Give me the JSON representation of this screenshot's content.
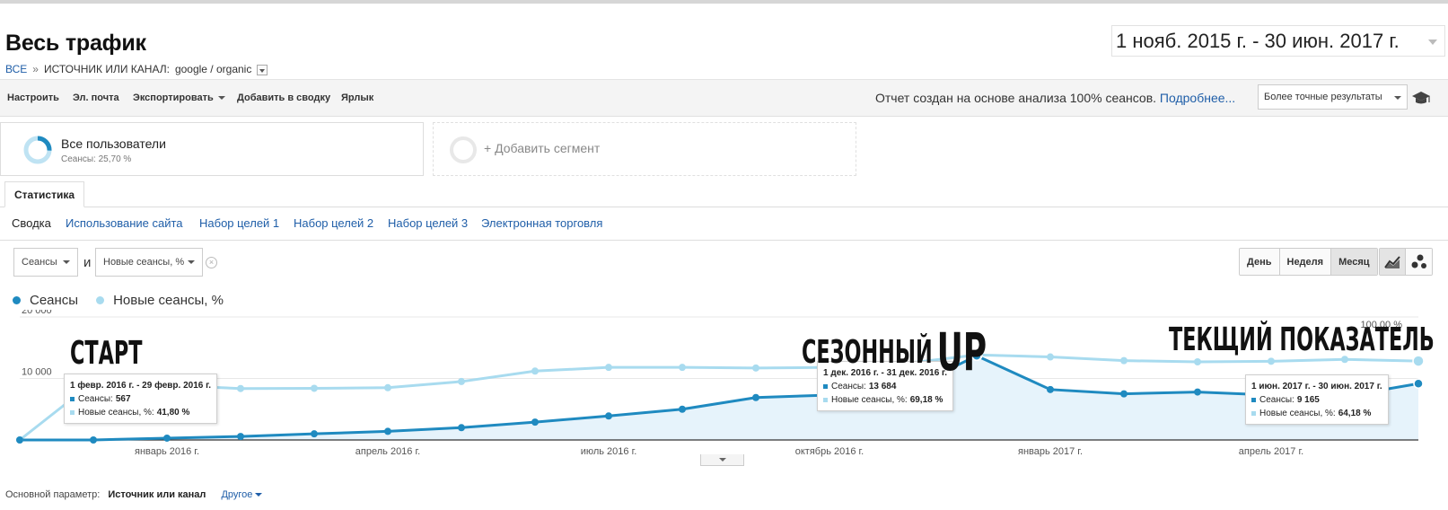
{
  "header": {
    "title": "Весь трафик",
    "crumb_all": "ВСЕ",
    "crumb_sep": "»",
    "crumb_dimension": "ИСТОЧНИК ИЛИ КАНАЛ:",
    "crumb_value": "google / organic",
    "date_range": "1 нояб. 2015 г. - 30 июн. 2017 г."
  },
  "toolbar": {
    "customize": "Настроить",
    "email": "Эл. почта",
    "export": "Экспортировать",
    "add_dashboard": "Добавить в сводку",
    "shortcut": "Ярлык",
    "report_note": "Отчет создан на основе анализа 100% сеансов.",
    "more_link": "Подробнее...",
    "precision": "Более точные результаты"
  },
  "segments": {
    "active_name": "Все пользователи",
    "active_sub": "Сеансы: 25,70 %",
    "active_fraction": 0.257,
    "add_label": "+ Добавить сегмент"
  },
  "tabs": {
    "statistics": "Статистика"
  },
  "subnav": [
    "Сводка",
    "Использование сайта",
    "Набор целей 1",
    "Набор целей 2",
    "Набор целей 3",
    "Электронная торговля"
  ],
  "controls": {
    "metric1": "Сеансы",
    "and": "и",
    "metric2": "Новые сеансы, %",
    "periods": [
      "День",
      "Неделя",
      "Месяц"
    ]
  },
  "legend": {
    "series1": "Сеансы",
    "series2": "Новые сеансы, %"
  },
  "tooltips": [
    {
      "title": "1 февр. 2016 г. - 29 февр. 2016 г.",
      "l1": "Сеансы:",
      "v1": "567",
      "l2": "Новые сеансы, %:",
      "v2": "41,80 %"
    },
    {
      "title": "1 дек. 2016 г. - 31 дек. 2016 г.",
      "l1": "Сеансы:",
      "v1": "13 684",
      "l2": "Новые сеансы, %:",
      "v2": "69,18 %"
    },
    {
      "title": "1 июн. 2017 г. - 30 июн. 2017 г.",
      "l1": "Сеансы:",
      "v1": "9 165",
      "l2": "Новые сеансы, %:",
      "v2": "64,18 %"
    }
  ],
  "annotations": {
    "start": "СТАРТ",
    "seasonal": "СЕЗОННЫЙ",
    "up": "UP",
    "current": "ТЕКЩИЙ ПОКАЗАТЕЛЬ"
  },
  "bottom": {
    "label": "Основной параметр:",
    "value": "Источник или канал",
    "other": "Другое"
  },
  "colors": {
    "sessions": "#1f8ac0",
    "new_sessions": "#a8dbef",
    "area_fill": "#e6f3fb",
    "link": "#1f5ea8"
  },
  "chart_data": {
    "type": "line",
    "x": [
      "нояб. 2015 г.",
      "дек. 2015 г.",
      "янв. 2016 г.",
      "февр. 2016 г.",
      "март 2016 г.",
      "апр. 2016 г.",
      "май 2016 г.",
      "июн. 2016 г.",
      "июл. 2016 г.",
      "авг. 2016 г.",
      "сент. 2016 г.",
      "окт. 2016 г.",
      "нояб. 2016 г.",
      "дек. 2016 г.",
      "янв. 2017 г.",
      "февр. 2017 г.",
      "март 2017 г.",
      "апр. 2017 г.",
      "май 2017 г.",
      "июн. 2017 г."
    ],
    "x_tick_labels": [
      "январь 2016 г.",
      "апрель 2016 г.",
      "июль 2016 г.",
      "октябрь 2016 г.",
      "январь 2017 г.",
      "апрель 2017 г."
    ],
    "x_tick_indices": [
      2,
      5,
      8,
      11,
      14,
      17
    ],
    "series": [
      {
        "name": "Сеансы",
        "axis": "left",
        "values": [
          0,
          0,
          300,
          567,
          1000,
          1400,
          2000,
          2900,
          3900,
          5000,
          6900,
          7300,
          7900,
          13684,
          8200,
          7500,
          7800,
          7300,
          7100,
          9165
        ]
      },
      {
        "name": "Новые сеансы, %",
        "axis": "right",
        "values": [
          0,
          47,
          44.5,
          41.8,
          42,
          42.5,
          47.5,
          56,
          59,
          59,
          58.5,
          59,
          62,
          69.18,
          67.5,
          64.5,
          63.5,
          64,
          65.5,
          64.18
        ]
      }
    ],
    "y_left": {
      "ticks": [
        10000,
        20000
      ],
      "tick_labels": [
        "10 000",
        "20 000"
      ],
      "range": [
        0,
        20000
      ]
    },
    "y_right": {
      "tick_labels": [
        "100,00 %"
      ],
      "range": [
        0,
        100
      ]
    },
    "grid": true
  }
}
